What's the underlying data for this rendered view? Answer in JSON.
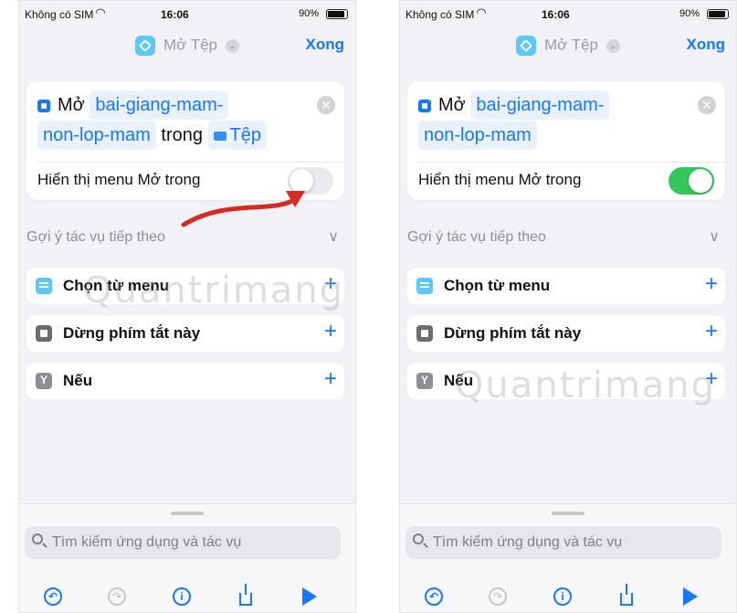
{
  "status": {
    "carrier": "Không có SIM",
    "time": "16:06",
    "battery": "90%"
  },
  "nav": {
    "title": "Mở Tệp",
    "done": "Xong"
  },
  "action": {
    "verb": "Mở",
    "file_part1": "bai-giang-mam-",
    "file_part2": "non-lop-mam",
    "connector": "trong",
    "app": "Tệp",
    "toggle_label": "Hiển thị menu Mở trong"
  },
  "toggle_states": {
    "left": "off",
    "right": "on"
  },
  "suggestions": {
    "header": "Gợi ý tác vụ tiếp theo",
    "items": [
      {
        "label": "Chọn từ menu",
        "icon": "menu-icon"
      },
      {
        "label": "Dừng phím tắt này",
        "icon": "stop-icon"
      },
      {
        "label": "Nếu",
        "icon": "if-icon"
      }
    ]
  },
  "search": {
    "placeholder": "Tìm kiếm ứng dụng và tác vụ"
  },
  "watermark": "Quantrimang",
  "colors": {
    "accent": "#1677ff",
    "toggle_on": "#34c759",
    "arrow": "#d62a22"
  }
}
